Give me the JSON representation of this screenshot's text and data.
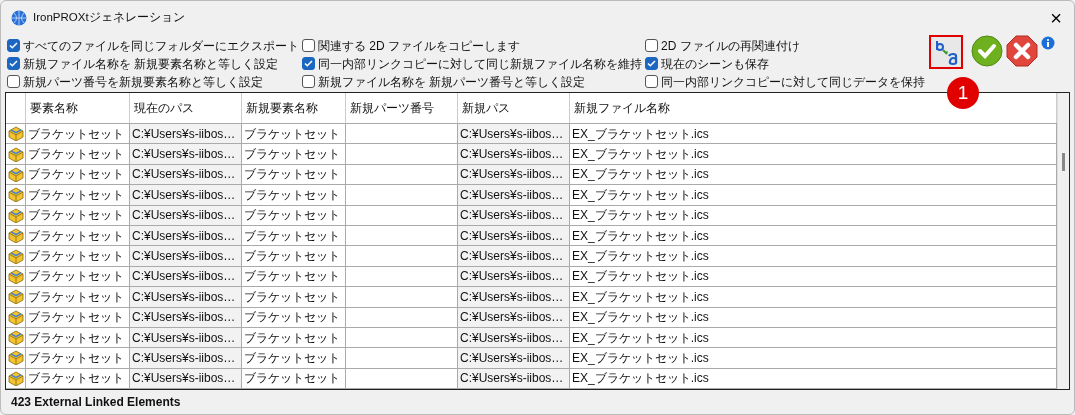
{
  "window": {
    "title": "IronPROXtジェネレーション",
    "close": "×"
  },
  "options": [
    {
      "label": "すべてのファイルを同じフォルダーにエクスポート",
      "checked": true
    },
    {
      "label": "関連する 2D ファイルをコピーします",
      "checked": false
    },
    {
      "label": "2D ファイルの再関連付け",
      "checked": false
    },
    {
      "label": "新規ファイル名称を 新規要素名称と等しく設定",
      "checked": true
    },
    {
      "label": "同一内部リンクコピーに対して同じ新規ファイル名称を維持",
      "checked": true
    },
    {
      "label": "現在のシーンも保存",
      "checked": true
    },
    {
      "label": "新規パーツ番号を新規要素名称と等しく設定",
      "checked": false
    },
    {
      "label": "新規ファイル名称を 新規パーツ番号と等しく設定",
      "checked": false
    },
    {
      "label": "同一内部リンクコピーに対して同じデータを保持",
      "checked": false
    }
  ],
  "callout": "1",
  "table": {
    "columns": [
      "要素名称",
      "現在のパス",
      "新規要素名称",
      "新規パーツ番号",
      "新規パス",
      "新規ファイル名称"
    ],
    "rows": [
      [
        "ブラケットセット",
        "C:¥Users¥s-iibos…",
        "ブラケットセット",
        "",
        "C:¥Users¥s-iibos…",
        "EX_ブラケットセット.ics"
      ],
      [
        "ブラケットセット",
        "C:¥Users¥s-iibos…",
        "ブラケットセット",
        "",
        "C:¥Users¥s-iibos…",
        "EX_ブラケットセット.ics"
      ],
      [
        "ブラケットセット",
        "C:¥Users¥s-iibos…",
        "ブラケットセット",
        "",
        "C:¥Users¥s-iibos…",
        "EX_ブラケットセット.ics"
      ],
      [
        "ブラケットセット",
        "C:¥Users¥s-iibos…",
        "ブラケットセット",
        "",
        "C:¥Users¥s-iibos…",
        "EX_ブラケットセット.ics"
      ],
      [
        "ブラケットセット",
        "C:¥Users¥s-iibos…",
        "ブラケットセット",
        "",
        "C:¥Users¥s-iibos…",
        "EX_ブラケットセット.ics"
      ],
      [
        "ブラケットセット",
        "C:¥Users¥s-iibos…",
        "ブラケットセット",
        "",
        "C:¥Users¥s-iibos…",
        "EX_ブラケットセット.ics"
      ],
      [
        "ブラケットセット",
        "C:¥Users¥s-iibos…",
        "ブラケットセット",
        "",
        "C:¥Users¥s-iibos…",
        "EX_ブラケットセット.ics"
      ],
      [
        "ブラケットセット",
        "C:¥Users¥s-iibos…",
        "ブラケットセット",
        "",
        "C:¥Users¥s-iibos…",
        "EX_ブラケットセット.ics"
      ],
      [
        "ブラケットセット",
        "C:¥Users¥s-iibos…",
        "ブラケットセット",
        "",
        "C:¥Users¥s-iibos…",
        "EX_ブラケットセット.ics"
      ],
      [
        "ブラケットセット",
        "C:¥Users¥s-iibos…",
        "ブラケットセット",
        "",
        "C:¥Users¥s-iibos…",
        "EX_ブラケットセット.ics"
      ],
      [
        "ブラケットセット",
        "C:¥Users¥s-iibos…",
        "ブラケットセット",
        "",
        "C:¥Users¥s-iibos…",
        "EX_ブラケットセット.ics"
      ],
      [
        "ブラケットセット",
        "C:¥Users¥s-iibos…",
        "ブラケットセット",
        "",
        "C:¥Users¥s-iibos…",
        "EX_ブラケットセット.ics"
      ],
      [
        "ブラケットセット",
        "C:¥Users¥s-iibos…",
        "ブラケットセット",
        "",
        "C:¥Users¥s-iibos…",
        "EX_ブラケットセット.ics"
      ]
    ]
  },
  "status_bar": "423 External Linked Elements"
}
